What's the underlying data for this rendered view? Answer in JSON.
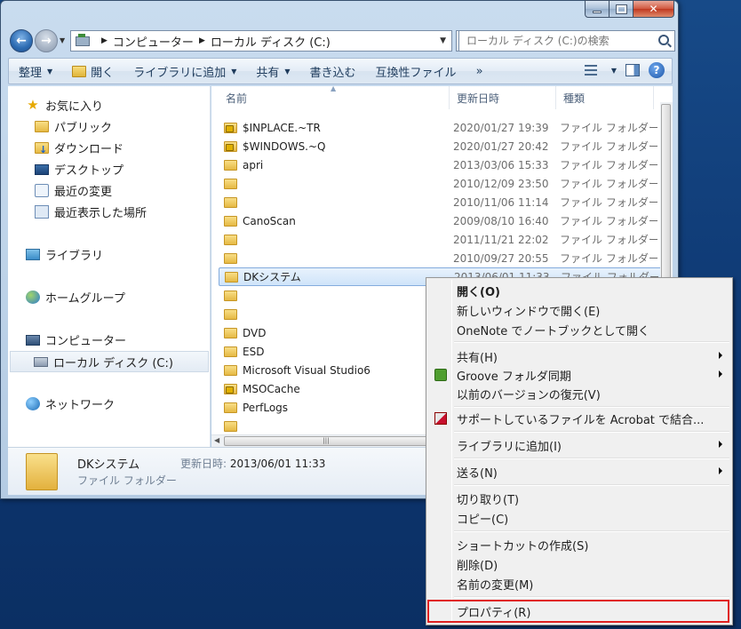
{
  "window": {
    "address": {
      "crumbs": [
        "コンピューター",
        "ローカル ディスク (C:)"
      ]
    },
    "search": {
      "placeholder": "ローカル ディスク (C:)の検索"
    },
    "toolbar": {
      "organize": "整理",
      "open": "開く",
      "add_to_library": "ライブラリに追加",
      "share": "共有",
      "burn": "書き込む",
      "compat_files": "互換性ファイル",
      "more": "»"
    },
    "nav": {
      "favorites": "お気に入り",
      "public": "パブリック",
      "downloads": "ダウンロード",
      "desktop": "デスクトップ",
      "recent_changes": "最近の変更",
      "recent_places": "最近表示した場所",
      "libraries": "ライブラリ",
      "homegroup": "ホームグループ",
      "computer": "コンピューター",
      "local_disk": "ローカル ディスク (C:)",
      "network": "ネットワーク"
    },
    "columns": {
      "name": "名前",
      "date": "更新日時",
      "type": "種類"
    },
    "files": [
      {
        "name": "$INPLACE.~TR",
        "date": "2020/01/27 19:39",
        "type": "ファイル フォルダー",
        "locked": true
      },
      {
        "name": "$WINDOWS.~Q",
        "date": "2020/01/27 20:42",
        "type": "ファイル フォルダー",
        "locked": true
      },
      {
        "name": "apri",
        "date": "2013/03/06 15:33",
        "type": "ファイル フォルダー",
        "locked": false
      },
      {
        "name": "",
        "date": "2010/12/09 23:50",
        "type": "ファイル フォルダー",
        "locked": false
      },
      {
        "name": "",
        "date": "2010/11/06 11:14",
        "type": "ファイル フォルダー",
        "locked": false
      },
      {
        "name": "CanoScan",
        "date": "2009/08/10 16:40",
        "type": "ファイル フォルダー",
        "locked": false
      },
      {
        "name": "",
        "date": "2011/11/21 22:02",
        "type": "ファイル フォルダー",
        "locked": false
      },
      {
        "name": "",
        "date": "2010/09/27 20:55",
        "type": "ファイル フォルダー",
        "locked": false
      },
      {
        "name": "DKシステム",
        "date": "2013/06/01 11:33",
        "type": "ファイル フォルダー",
        "locked": false,
        "selected": true
      },
      {
        "name": "",
        "date": "",
        "type": "",
        "locked": false
      },
      {
        "name": "",
        "date": "",
        "type": "",
        "locked": false
      },
      {
        "name": "DVD",
        "date": "",
        "type": "",
        "locked": false
      },
      {
        "name": "ESD",
        "date": "",
        "type": "",
        "locked": false
      },
      {
        "name": "Microsoft Visual Studio6",
        "date": "",
        "type": "",
        "locked": false
      },
      {
        "name": "MSOCache",
        "date": "",
        "type": "",
        "locked": true
      },
      {
        "name": "PerfLogs",
        "date": "",
        "type": "",
        "locked": false
      },
      {
        "name": "",
        "date": "",
        "type": "",
        "locked": false
      }
    ],
    "details": {
      "name": "DKシステム",
      "type": "ファイル フォルダー",
      "date_label": "更新日時:",
      "date_value": "2013/06/01 11:33"
    }
  },
  "context_menu": {
    "open": "開く(O)",
    "new_window": "新しいウィンドウで開く(E)",
    "onenote": "OneNote でノートブックとして開く",
    "share": "共有(H)",
    "groove": "Groove フォルダ同期",
    "restore": "以前のバージョンの復元(V)",
    "acrobat": "サポートしているファイルを Acrobat で結合...",
    "add_library": "ライブラリに追加(I)",
    "send_to": "送る(N)",
    "cut": "切り取り(T)",
    "copy": "コピー(C)",
    "create_shortcut": "ショートカットの作成(S)",
    "delete": "削除(D)",
    "rename": "名前の変更(M)",
    "properties": "プロパティ(R)"
  },
  "colors": {
    "highlight_box": "#e02020",
    "desktop_bg": "#0e3468"
  }
}
